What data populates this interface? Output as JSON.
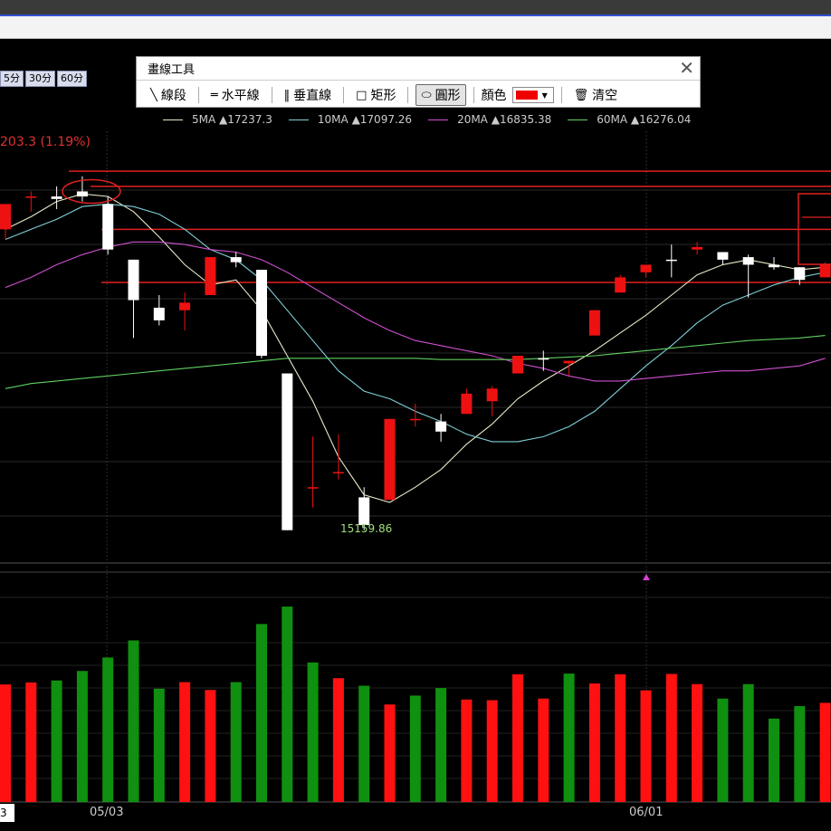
{
  "drawing_toolbar": {
    "title": "畫線工具",
    "close": "✕",
    "tools": [
      {
        "icon": "line-segment-icon",
        "label": "線段"
      },
      {
        "icon": "horizontal-line-icon",
        "label": "水平線"
      },
      {
        "icon": "vertical-line-icon",
        "label": "垂直線"
      },
      {
        "icon": "rectangle-icon",
        "label": "矩形"
      },
      {
        "icon": "ellipse-icon",
        "label": "圓形",
        "active": true
      }
    ],
    "color_label": "顏色",
    "color_value": "#ee0000",
    "clear_label": "清空"
  },
  "interval_tabs": [
    "5分",
    "30分",
    "60分"
  ],
  "legend": [
    {
      "name": "5MA",
      "value": "▲17237.3",
      "color": "#e8e8c8"
    },
    {
      "name": "10MA",
      "value": "▲17097.26",
      "color": "#7fd0d8"
    },
    {
      "name": "20MA",
      "value": "▲16835.38",
      "color": "#d050d0"
    },
    {
      "name": "60MA",
      "value": "▲16276.04",
      "color": "#60d060"
    }
  ],
  "change_text": "203.3 (1.19%)",
  "low_label": "15159.86",
  "dates": {
    "d1": "05/03",
    "d2": "06/01"
  },
  "volume_box": "3",
  "colors": {
    "up": "#ee1111",
    "down": "#ffffff",
    "vol_up": "#ff1111",
    "vol_down": "#109010",
    "annotation": "#e02020"
  },
  "chart_data": {
    "type": "candlestick",
    "x_ticks": [
      "05/03",
      "06/01"
    ],
    "low_label": "15159.86",
    "candles": [
      {
        "o": 16980,
        "h": 16980,
        "l": 16840,
        "c": 16880,
        "up": true
      },
      {
        "o": 17010,
        "h": 17030,
        "l": 16950,
        "c": 17010,
        "up": true
      },
      {
        "o": 17010,
        "h": 17050,
        "l": 16960,
        "c": 17000,
        "up": false
      },
      {
        "o": 17030,
        "h": 17090,
        "l": 16990,
        "c": 17010,
        "up": false
      },
      {
        "o": 16980,
        "h": 17010,
        "l": 16780,
        "c": 16800,
        "up": false
      },
      {
        "o": 16760,
        "h": 16760,
        "l": 16450,
        "c": 16600,
        "up": false
      },
      {
        "o": 16570,
        "h": 16620,
        "l": 16500,
        "c": 16520,
        "up": false
      },
      {
        "o": 16560,
        "h": 16630,
        "l": 16480,
        "c": 16590,
        "up": true
      },
      {
        "o": 16620,
        "h": 16770,
        "l": 16620,
        "c": 16770,
        "up": true
      },
      {
        "o": 16770,
        "h": 16790,
        "l": 16730,
        "c": 16750,
        "up": false
      },
      {
        "o": 16720,
        "h": 16720,
        "l": 16370,
        "c": 16380,
        "up": false
      },
      {
        "o": 16310,
        "h": 16310,
        "l": 15690,
        "c": 15690,
        "up": false
      },
      {
        "o": 15860,
        "h": 16060,
        "l": 15780,
        "c": 15860,
        "up": true
      },
      {
        "o": 15920,
        "h": 16070,
        "l": 15890,
        "c": 15920,
        "up": true
      },
      {
        "o": 15820,
        "h": 15860,
        "l": 15690,
        "c": 15710,
        "up": false
      },
      {
        "o": 15810,
        "h": 16130,
        "l": 15810,
        "c": 16130,
        "up": true
      },
      {
        "o": 16130,
        "h": 16190,
        "l": 16100,
        "c": 16130,
        "up": true
      },
      {
        "o": 16120,
        "h": 16150,
        "l": 16040,
        "c": 16080,
        "up": false
      },
      {
        "o": 16150,
        "h": 16250,
        "l": 16150,
        "c": 16230,
        "up": true
      },
      {
        "o": 16200,
        "h": 16260,
        "l": 16140,
        "c": 16250,
        "up": true
      },
      {
        "o": 16310,
        "h": 16370,
        "l": 16310,
        "c": 16380,
        "up": true
      },
      {
        "o": 16370,
        "h": 16400,
        "l": 16320,
        "c": 16370,
        "up": false
      },
      {
        "o": 16360,
        "h": 16360,
        "l": 16300,
        "c": 16350,
        "up": true
      },
      {
        "o": 16460,
        "h": 16560,
        "l": 16460,
        "c": 16560,
        "up": true
      },
      {
        "o": 16630,
        "h": 16700,
        "l": 16630,
        "c": 16690,
        "up": true
      },
      {
        "o": 16710,
        "h": 16740,
        "l": 16690,
        "c": 16740,
        "up": true
      },
      {
        "o": 16760,
        "h": 16820,
        "l": 16690,
        "c": 16760,
        "up": false
      },
      {
        "o": 16800,
        "h": 16830,
        "l": 16780,
        "c": 16810,
        "up": true
      },
      {
        "o": 16790,
        "h": 16790,
        "l": 16740,
        "c": 16760,
        "up": false
      },
      {
        "o": 16770,
        "h": 16780,
        "l": 16610,
        "c": 16740,
        "up": false
      },
      {
        "o": 16740,
        "h": 16770,
        "l": 16720,
        "c": 16730,
        "up": false
      },
      {
        "o": 16730,
        "h": 16730,
        "l": 16660,
        "c": 16680,
        "up": false
      },
      {
        "o": 16690,
        "h": 16750,
        "l": 16690,
        "c": 16740,
        "up": true
      }
    ],
    "volumes": [
      {
        "v": 3580,
        "up": true
      },
      {
        "v": 3640,
        "up": true
      },
      {
        "v": 3700,
        "up": false
      },
      {
        "v": 3990,
        "up": false
      },
      {
        "v": 4400,
        "up": false
      },
      {
        "v": 4920,
        "up": false
      },
      {
        "v": 3450,
        "up": false
      },
      {
        "v": 3650,
        "up": true
      },
      {
        "v": 3410,
        "up": true
      },
      {
        "v": 3650,
        "up": false
      },
      {
        "v": 5420,
        "up": false
      },
      {
        "v": 5950,
        "up": false
      },
      {
        "v": 4250,
        "up": false
      },
      {
        "v": 3770,
        "up": true
      },
      {
        "v": 3540,
        "up": false
      },
      {
        "v": 2970,
        "up": true
      },
      {
        "v": 3240,
        "up": false
      },
      {
        "v": 3470,
        "up": false
      },
      {
        "v": 3120,
        "up": true
      },
      {
        "v": 3100,
        "up": true
      },
      {
        "v": 3890,
        "up": true
      },
      {
        "v": 3150,
        "up": true
      },
      {
        "v": 3910,
        "up": false
      },
      {
        "v": 3610,
        "up": true
      },
      {
        "v": 3890,
        "up": true
      },
      {
        "v": 3400,
        "up": true
      },
      {
        "v": 3900,
        "up": true
      },
      {
        "v": 3590,
        "up": true
      },
      {
        "v": 3150,
        "up": false
      },
      {
        "v": 3590,
        "up": false
      },
      {
        "v": 2540,
        "up": false
      },
      {
        "v": 2920,
        "up": false
      },
      {
        "v": 3020,
        "up": true
      }
    ],
    "ma": {
      "ma5": [
        16880,
        16930,
        16990,
        17020,
        17010,
        16950,
        16850,
        16740,
        16660,
        16680,
        16560,
        16380,
        16200,
        15980,
        15830,
        15800,
        15860,
        15930,
        16030,
        16110,
        16210,
        16280,
        16340,
        16400,
        16470,
        16540,
        16620,
        16700,
        16740,
        16760,
        16740,
        16720,
        16730
      ],
      "ma10": [
        16840,
        16880,
        16920,
        16970,
        16980,
        16970,
        16940,
        16880,
        16800,
        16760,
        16680,
        16560,
        16440,
        16320,
        16240,
        16210,
        16160,
        16120,
        16070,
        16040,
        16040,
        16060,
        16100,
        16160,
        16250,
        16340,
        16420,
        16510,
        16580,
        16620,
        16660,
        16690,
        16710
      ],
      "ma20": [
        16650,
        16690,
        16740,
        16780,
        16810,
        16830,
        16830,
        16820,
        16800,
        16790,
        16760,
        16710,
        16650,
        16590,
        16530,
        16480,
        16440,
        16420,
        16400,
        16380,
        16350,
        16330,
        16300,
        16280,
        16280,
        16290,
        16300,
        16310,
        16320,
        16320,
        16330,
        16340,
        16370
      ],
      "ma60": [
        16250,
        16270,
        16280,
        16290,
        16300,
        16310,
        16320,
        16330,
        16340,
        16350,
        16360,
        16370,
        16370,
        16370,
        16370,
        16370,
        16370,
        16365,
        16365,
        16365,
        16365,
        16370,
        16375,
        16380,
        16390,
        16400,
        16410,
        16420,
        16430,
        16440,
        16445,
        16450,
        16460
      ]
    },
    "horizontal_lines": [
      17110,
      17050,
      16880,
      16670
    ],
    "annotation_ellipse_value": 17030,
    "ylim": [
      15560,
      17250
    ],
    "vol_ylim": [
      0,
      7000
    ]
  }
}
